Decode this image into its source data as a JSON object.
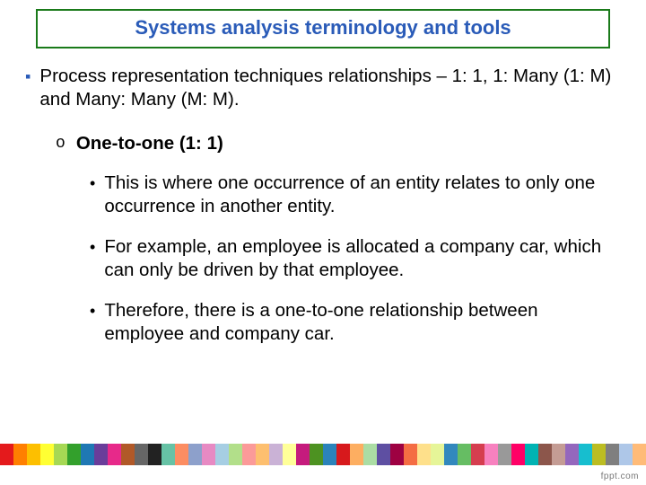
{
  "title": "Systems analysis terminology and tools",
  "main_bullet": "Process representation techniques relationships – 1: 1, 1: Many (1: M) and Many: Many (M: M).",
  "sub_marker": "o",
  "sub_heading": "One-to-one (1: 1)",
  "points": [
    "This is where one occurrence of an entity relates to only one occurrence in another entity.",
    "For example, an employee is allocated a company car, which can only be driven by that employee.",
    "Therefore, there is a one-to-one relationship between employee and company car."
  ],
  "footer_colors": [
    "#e41a1c",
    "#ff7f00",
    "#fdbf00",
    "#ffff33",
    "#a6d854",
    "#33a02c",
    "#1f78b4",
    "#6a3d9a",
    "#e7298a",
    "#b15928",
    "#666666",
    "#222222",
    "#66c2a5",
    "#fc8d62",
    "#8da0cb",
    "#e78ac3",
    "#a6cee3",
    "#b2df8a",
    "#fb9a99",
    "#fdbf6f",
    "#cab2d6",
    "#ffff99",
    "#c51b7d",
    "#4d9221",
    "#2b83ba",
    "#d7191c",
    "#fdae61",
    "#abdda4",
    "#5e4fa2",
    "#9e0142",
    "#f46d43",
    "#fee08b",
    "#e6f598",
    "#3288bd",
    "#66bd63",
    "#d53e4f",
    "#f781bf",
    "#999999",
    "#ff0066",
    "#00b3b3",
    "#8c564b",
    "#c49c94",
    "#9467bd",
    "#17becf",
    "#bcbd22",
    "#7f7f7f",
    "#aec7e8",
    "#ffbb78"
  ],
  "logo_text": "fppt.com"
}
